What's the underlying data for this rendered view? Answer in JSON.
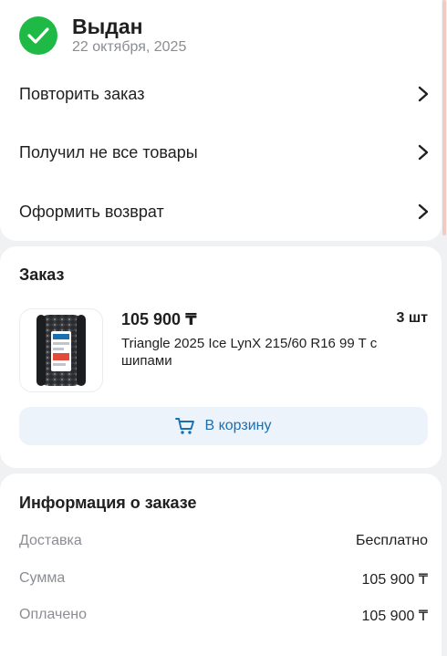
{
  "status": {
    "title": "Выдан",
    "date": "22 октября, 2025",
    "icon": "check-icon",
    "color": "#1fba45"
  },
  "actions": [
    {
      "label": "Повторить заказ"
    },
    {
      "label": "Получил не все товары"
    },
    {
      "label": "Оформить возврат"
    }
  ],
  "order": {
    "title": "Заказ",
    "item": {
      "price": "105 900 ₸",
      "quantity": "3 шт",
      "name": "Triangle 2025 Ice LynX 215/60 R16 99 T с шипами",
      "image": "tire-image"
    },
    "cart_button": "В корзину"
  },
  "info": {
    "title": "Информация о заказе",
    "rows": [
      {
        "label": "Доставка",
        "value": "Бесплатно"
      },
      {
        "label": "Сумма",
        "value": "105 900 ₸"
      },
      {
        "label": "Оплачено",
        "value": "105 900 ₸"
      }
    ]
  },
  "colors": {
    "accent": "#1a6fb0",
    "success": "#1fba45",
    "muted": "#8a8d93"
  }
}
